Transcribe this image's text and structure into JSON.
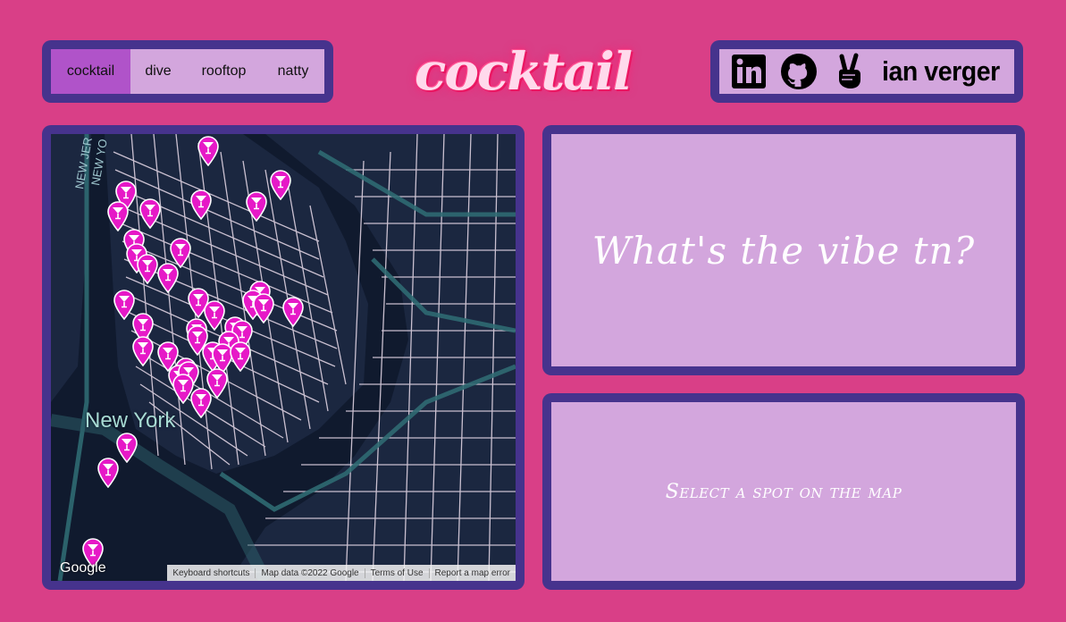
{
  "tabs": [
    {
      "label": "cocktail",
      "active": true
    },
    {
      "label": "dive",
      "active": false
    },
    {
      "label": "rooftop",
      "active": false
    },
    {
      "label": "natty",
      "active": false
    }
  ],
  "logo": "cocktail",
  "links": {
    "icons": [
      "linkedin-icon",
      "github-icon",
      "peace-hand-icon"
    ],
    "author": "ian verger"
  },
  "map": {
    "city_label": "New York",
    "nj_label": "NEW JER",
    "nj_label_2": "NEW YO",
    "google_logo": "Google",
    "attribution": {
      "shortcuts": "Keyboard shortcuts",
      "data": "Map data ©2022 Google",
      "terms": "Terms of Use",
      "report": "Report a map error"
    },
    "marker_icon": "cocktail-glass-icon",
    "marker_color": "#e619c7"
  },
  "vibe_panel": {
    "text": "What's the vibe tn?"
  },
  "detail_panel": {
    "text": "Select a spot on the map"
  },
  "colors": {
    "background": "#d93f87",
    "frame": "#46338d",
    "panel": "#d3a6dd",
    "active_tab": "#b053c9",
    "logo": "#ff2f7a"
  }
}
